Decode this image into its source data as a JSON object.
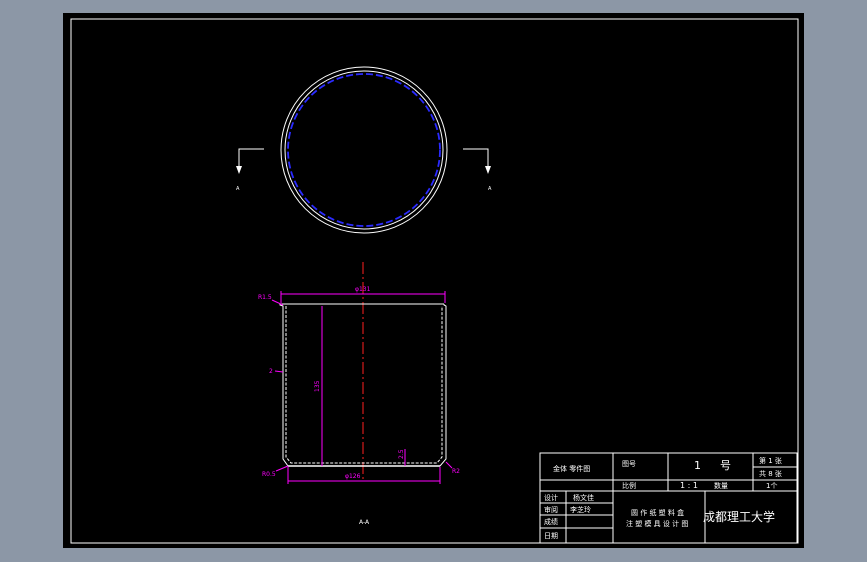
{
  "colors": {
    "background": "#8c97a6",
    "sheet": "#000000",
    "line": "#ffffff",
    "dimension": "#ff00ff",
    "centerline": "#ff2020",
    "hidden": "#2a2aff"
  },
  "top_view": {
    "section_mark_left": "A",
    "section_mark_right": "A"
  },
  "front_view": {
    "top_diameter": "φ131",
    "bottom_diameter": "φ126",
    "height": "135",
    "wall_top": "R1.5",
    "side_label": "2",
    "bottom_left": "R0.5",
    "bottom_right": "R2",
    "base_thickness": "2.5",
    "section_label": "A-A"
  },
  "title_block": {
    "drawing_title": "金体 零件图",
    "drawing_no_label": "图号",
    "drawing_no": "1",
    "drawing_no_unit": "号",
    "sheet_info_1": "第 1 张",
    "sheet_info_2": "共 8 张",
    "scale_label": "比例",
    "scale": "1 : 1",
    "qty_label": "数量",
    "qty": "1个",
    "design_label": "设计",
    "designer": "杨文佳",
    "review_label": "审阅",
    "reviewer": "李芝玲",
    "grade_label": "成绩",
    "date_label": "日期",
    "part_name_1": "圆 作 纸 塑 料 盒",
    "part_name_2": "注 塑 模 具 设 计 图",
    "school": "成都理工大学"
  }
}
